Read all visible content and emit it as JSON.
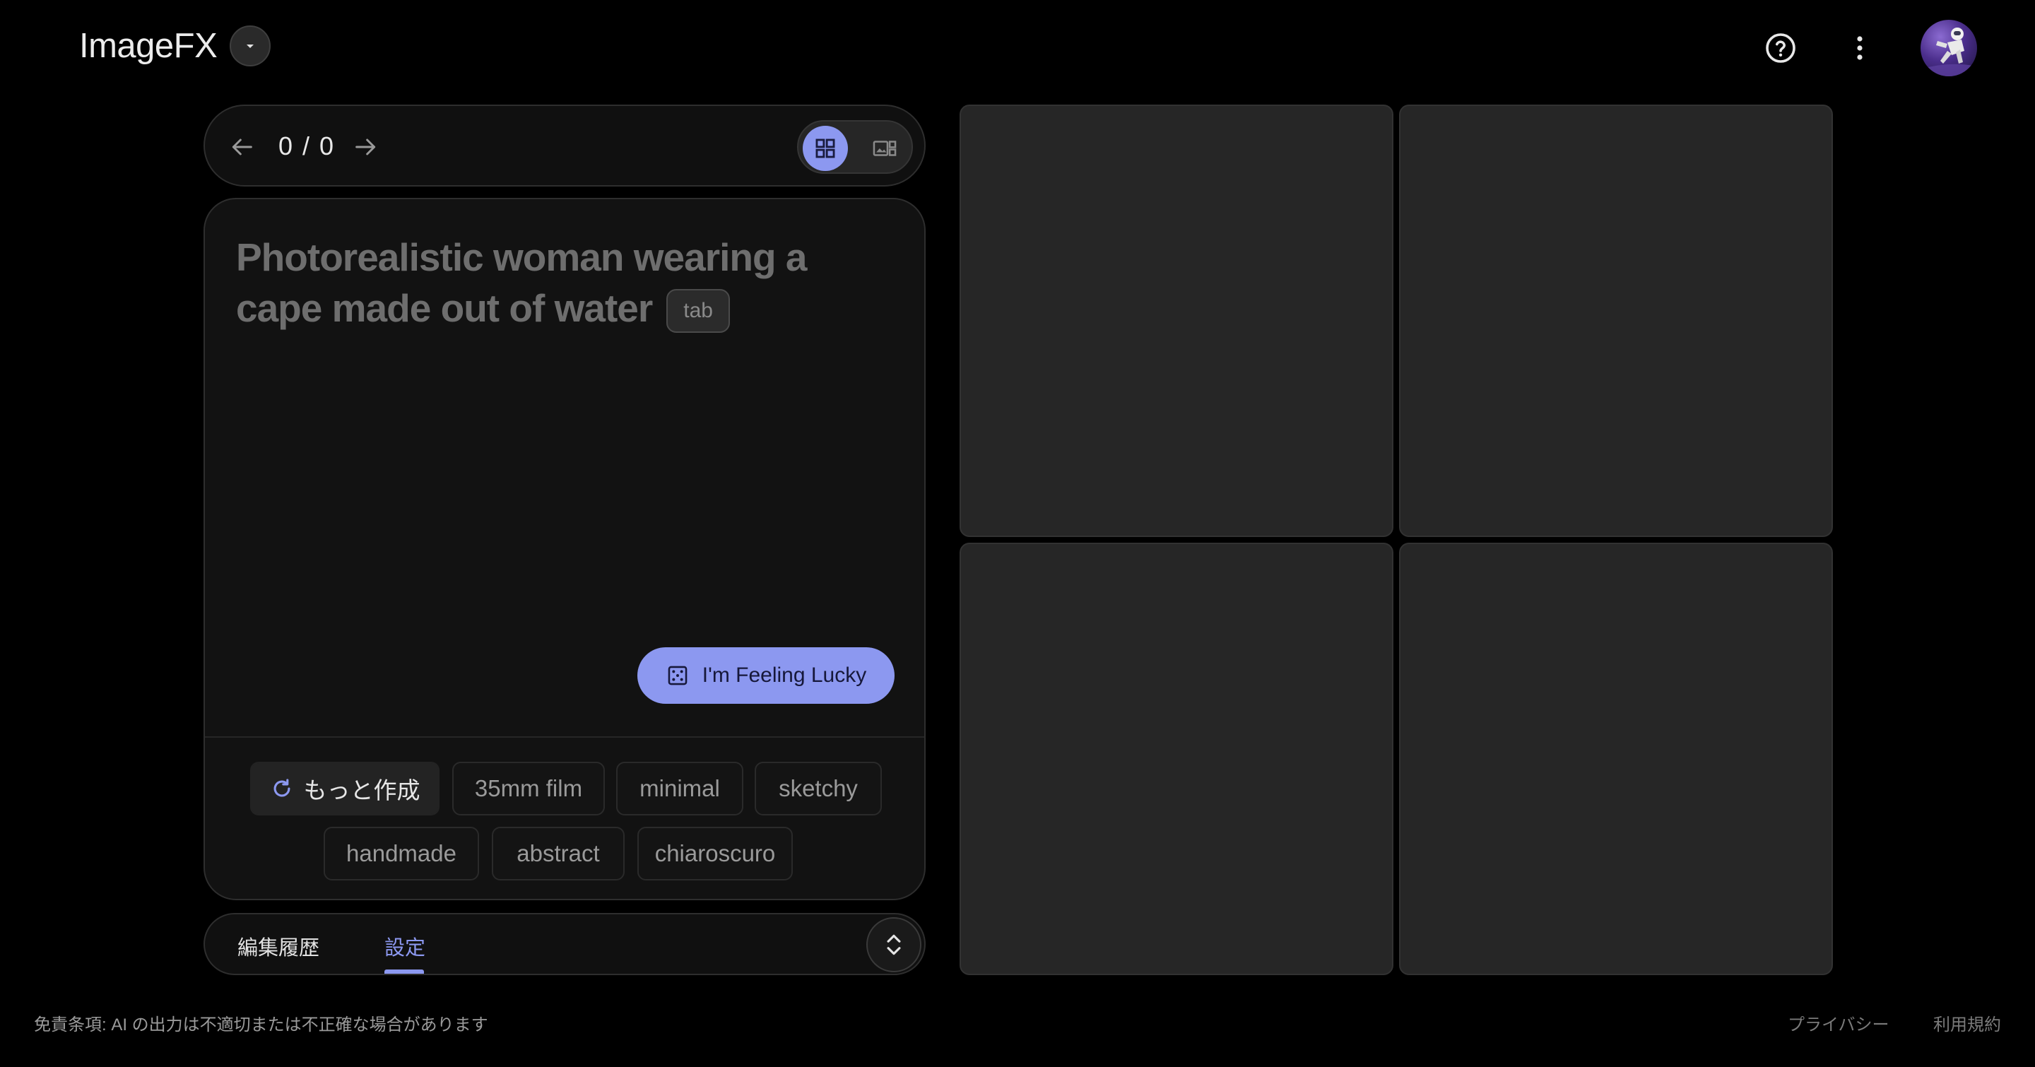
{
  "app": {
    "title": "ImageFX"
  },
  "nav": {
    "counter": "0 / 0"
  },
  "prompt": {
    "placeholder": "Photorealistic woman wearing a cape made out of water",
    "tab_hint": "tab",
    "lucky_label": "I'm Feeling Lucky"
  },
  "chips": {
    "more_label": "もっと作成",
    "items": [
      "35mm film",
      "minimal",
      "sketchy",
      "handmade",
      "abstract",
      "chiaroscuro"
    ]
  },
  "bottom_tabs": {
    "history": "編集履歴",
    "settings": "設定",
    "active": "設定"
  },
  "footer": {
    "disclaimer": "免責条項: AI の出力は不適切または不正確な場合があります",
    "privacy": "プライバシー",
    "terms": "利用規約"
  },
  "colors": {
    "accent": "#8c98f0",
    "background": "#000000",
    "tile": "#262626"
  },
  "icons": [
    "chevron-down-icon",
    "help-circle-icon",
    "more-vert-icon",
    "arrow-back-icon",
    "arrow-forward-icon",
    "grid-view-icon",
    "single-view-icon",
    "dice-icon",
    "refresh-icon",
    "expand-collapse-icon"
  ]
}
